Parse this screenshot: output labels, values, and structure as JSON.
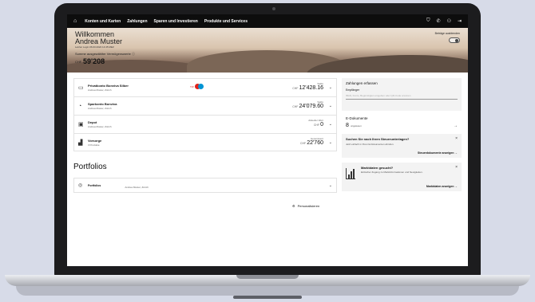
{
  "nav": {
    "home_icon": "home-icon",
    "items": [
      "Konten und Karten",
      "Zahlungen",
      "Sparen und Investieren",
      "Produkte und Services"
    ],
    "right_icons": [
      "shield-icon",
      "phone-icon",
      "user-icon",
      "logout-icon"
    ]
  },
  "hero": {
    "welcome": "Willkommen",
    "name": "Andrea Muster",
    "last_login": "Letzter Login 06.03.2024 14:45 MEZ",
    "assets_label": "Summe ausgewählter Vermögenswerte",
    "currency": "CHF",
    "total": "59'208",
    "amounts_label": "Beträge ausblenden"
  },
  "accounts": [
    {
      "title": "Privatkonto Bonviva Silber",
      "sub": "Andrea Muster, Zürich",
      "right_label": "Saldo",
      "currency": "CHF",
      "amount": "12'428.16",
      "icon": "wallet-icon"
    },
    {
      "title": "Sparkonto Bonviva",
      "sub": "Andrea Muster, Zürich",
      "right_label": "Saldo",
      "currency": "CHF",
      "amount": "24'079.60",
      "icon": "piggybank-icon"
    },
    {
      "title": "Depot",
      "sub": "Andrea Muster, Zürich",
      "right_label": "Aktueller Wert",
      "currency": "CHF",
      "amount": "0",
      "icon": "depot-icon"
    },
    {
      "title": "Vorsorge",
      "sub": "3 Produkte",
      "right_label": "Gesamtwert",
      "currency": "CHF",
      "amount": "22'760",
      "icon": "chart-icon"
    }
  ],
  "twint_label": "TW",
  "portfolios": {
    "title": "Portfolios",
    "item_title": "Portfolios",
    "item_sub": "Andrea Muster, Zürich"
  },
  "personalize_label": "Personalisieren",
  "payments": {
    "title": "Zahlungen erfassen",
    "recipient_label": "Empfänger",
    "recipient_placeholder": "IBAN, Konto, Begünstigten eingeben oder QR-Code scannen"
  },
  "edocs": {
    "title": "E-Dokumente",
    "count": "8",
    "unread_label": "ungelesen"
  },
  "tax": {
    "title": "Suchen Sie nach Ihren Steuerunterlagen?",
    "text": "Jetzt einfach in Ihren E-Dokumenten abrufen.",
    "link": "Steuerdokumente anzeigen"
  },
  "market": {
    "title": "Marktdaten gesucht?",
    "text": "Einfacher Zugang zu Marktinformationen und Neuigkeiten.",
    "link": "Marktdaten anzeigen"
  }
}
